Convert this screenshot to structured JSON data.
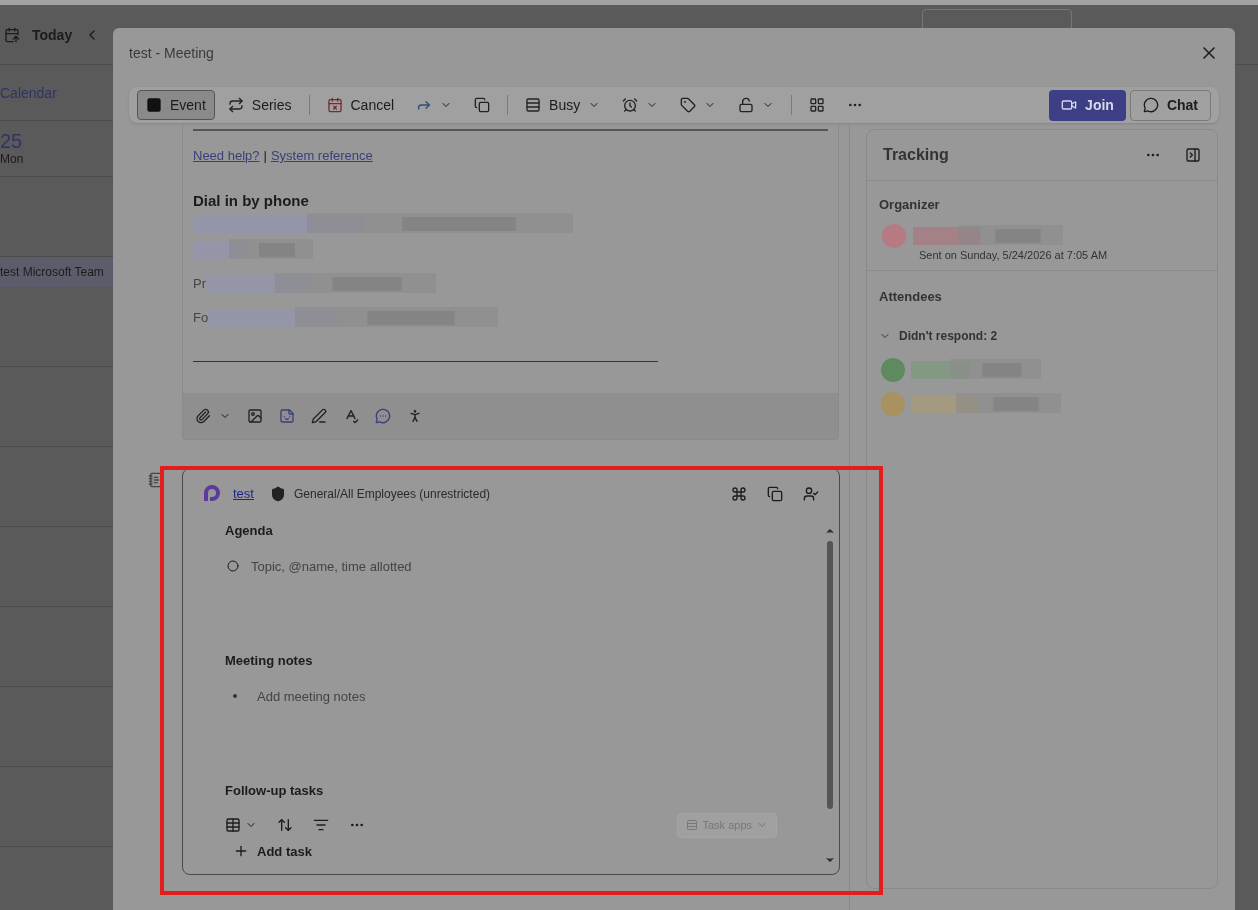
{
  "calendar": {
    "today": "Today",
    "title": "Calendar",
    "day_number": "25",
    "day_name": "Mon",
    "event": "test Microsoft Team"
  },
  "dialog": {
    "title": "test - Meeting",
    "toolbar": [
      {
        "kind": "button",
        "label": "Event",
        "selected": true
      },
      {
        "kind": "button",
        "label": "Series",
        "selected": false
      },
      {
        "kind": "button",
        "label": "Cancel",
        "selected": false
      },
      {
        "kind": "icon",
        "dropdown": true
      },
      {
        "kind": "icon",
        "dropdown": false
      },
      {
        "kind": "button",
        "label": "Busy",
        "dropdown": true,
        "selected": false
      },
      {
        "kind": "icon",
        "dropdown": true
      },
      {
        "kind": "icon",
        "dropdown": true
      },
      {
        "kind": "icon",
        "dropdown": true
      },
      {
        "kind": "icon",
        "dropdown": false
      },
      {
        "kind": "icon",
        "dropdown": false
      }
    ],
    "join": "Join",
    "chat": "Chat"
  },
  "body": {
    "links": [
      "Need help?",
      "System reference"
    ],
    "separator": "|",
    "heading": "Dial in by phone",
    "redacted_lines": [
      {
        "prefix": "Pr"
      },
      {
        "prefix": "Fo"
      }
    ]
  },
  "loop": {
    "workspace": "test",
    "label": "General/All Employees (unrestricted)",
    "sections": [
      {
        "kind": "agenda",
        "title": "Agenda",
        "placeholder": "Topic, @name, time allotted"
      },
      {
        "kind": "notes",
        "title": "Meeting notes",
        "placeholder": "Add meeting notes"
      },
      {
        "kind": "tasks",
        "title": "Follow-up tasks"
      }
    ],
    "task_apps": {
      "label": "Task apps",
      "disabled": true
    },
    "add_task": "Add task"
  },
  "tracking": {
    "title": "Tracking",
    "organizer_heading": "Organizer",
    "sent": "Sent on Sunday, 5/24/2026 at 7:05 AM",
    "attendees_heading": "Attendees",
    "groups": [
      {
        "label": "Didn't respond: 2",
        "expanded": true
      }
    ]
  }
}
